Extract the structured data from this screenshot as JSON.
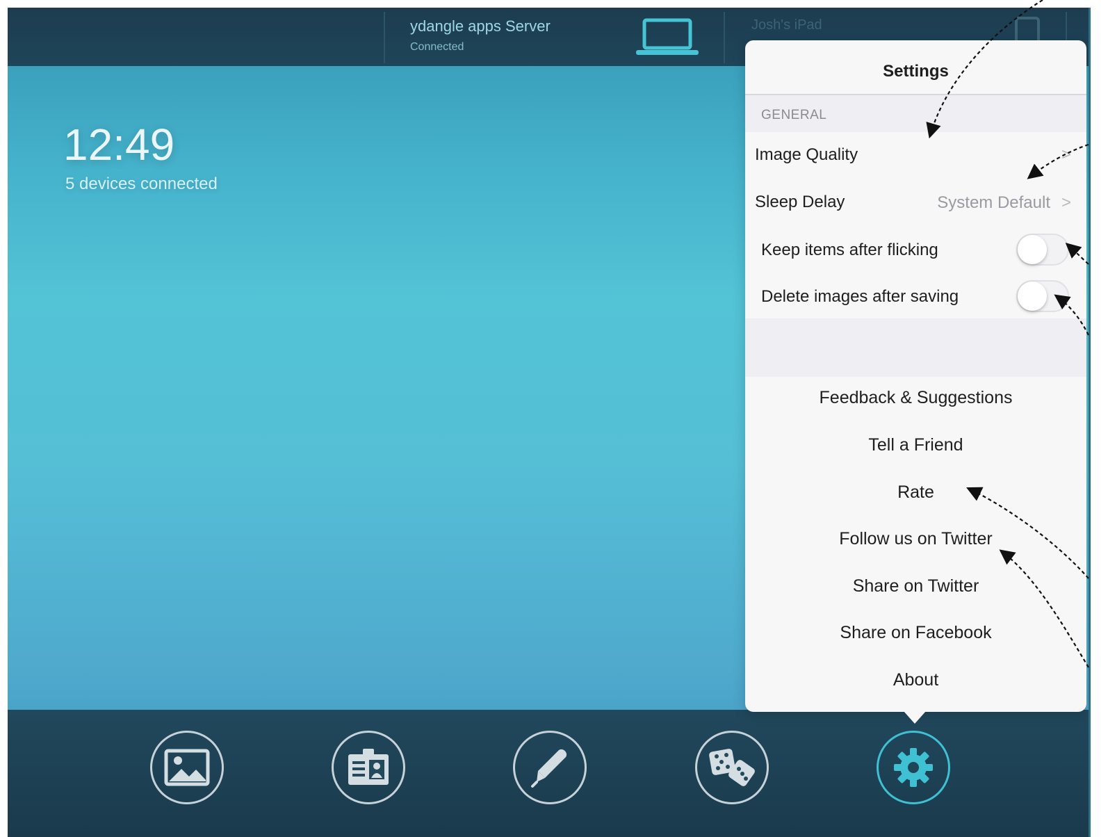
{
  "top_bar": {
    "server_name": "ydangle apps Server",
    "server_status": "Connected",
    "device2_name": "Josh's iPad"
  },
  "home": {
    "clock": "12:49",
    "devices_connected": "5 devices connected"
  },
  "settings": {
    "title": "Settings",
    "section_general": "GENERAL",
    "image_quality_label": "Image Quality",
    "sleep_delay_label": "Sleep Delay",
    "sleep_delay_value": "System Default",
    "chevron": ">",
    "keep_items_label": "Keep items after flicking",
    "keep_items_on": false,
    "delete_images_label": "Delete images after saving",
    "delete_images_on": false,
    "actions": [
      "Feedback & Suggestions",
      "Tell a Friend",
      "Rate",
      "Follow us on Twitter",
      "Share on Twitter",
      "Share on Facebook",
      "About"
    ]
  },
  "tab_bar": {
    "items": [
      "image-icon",
      "contact-card-icon",
      "pen-icon",
      "dice-icon",
      "gear-icon"
    ],
    "active": "gear-icon",
    "active_color": "#3fc0d3"
  },
  "colors": {
    "bar": "#1f4559",
    "accent": "#3fc0d3",
    "popover_bg": "#f7f7f8"
  }
}
